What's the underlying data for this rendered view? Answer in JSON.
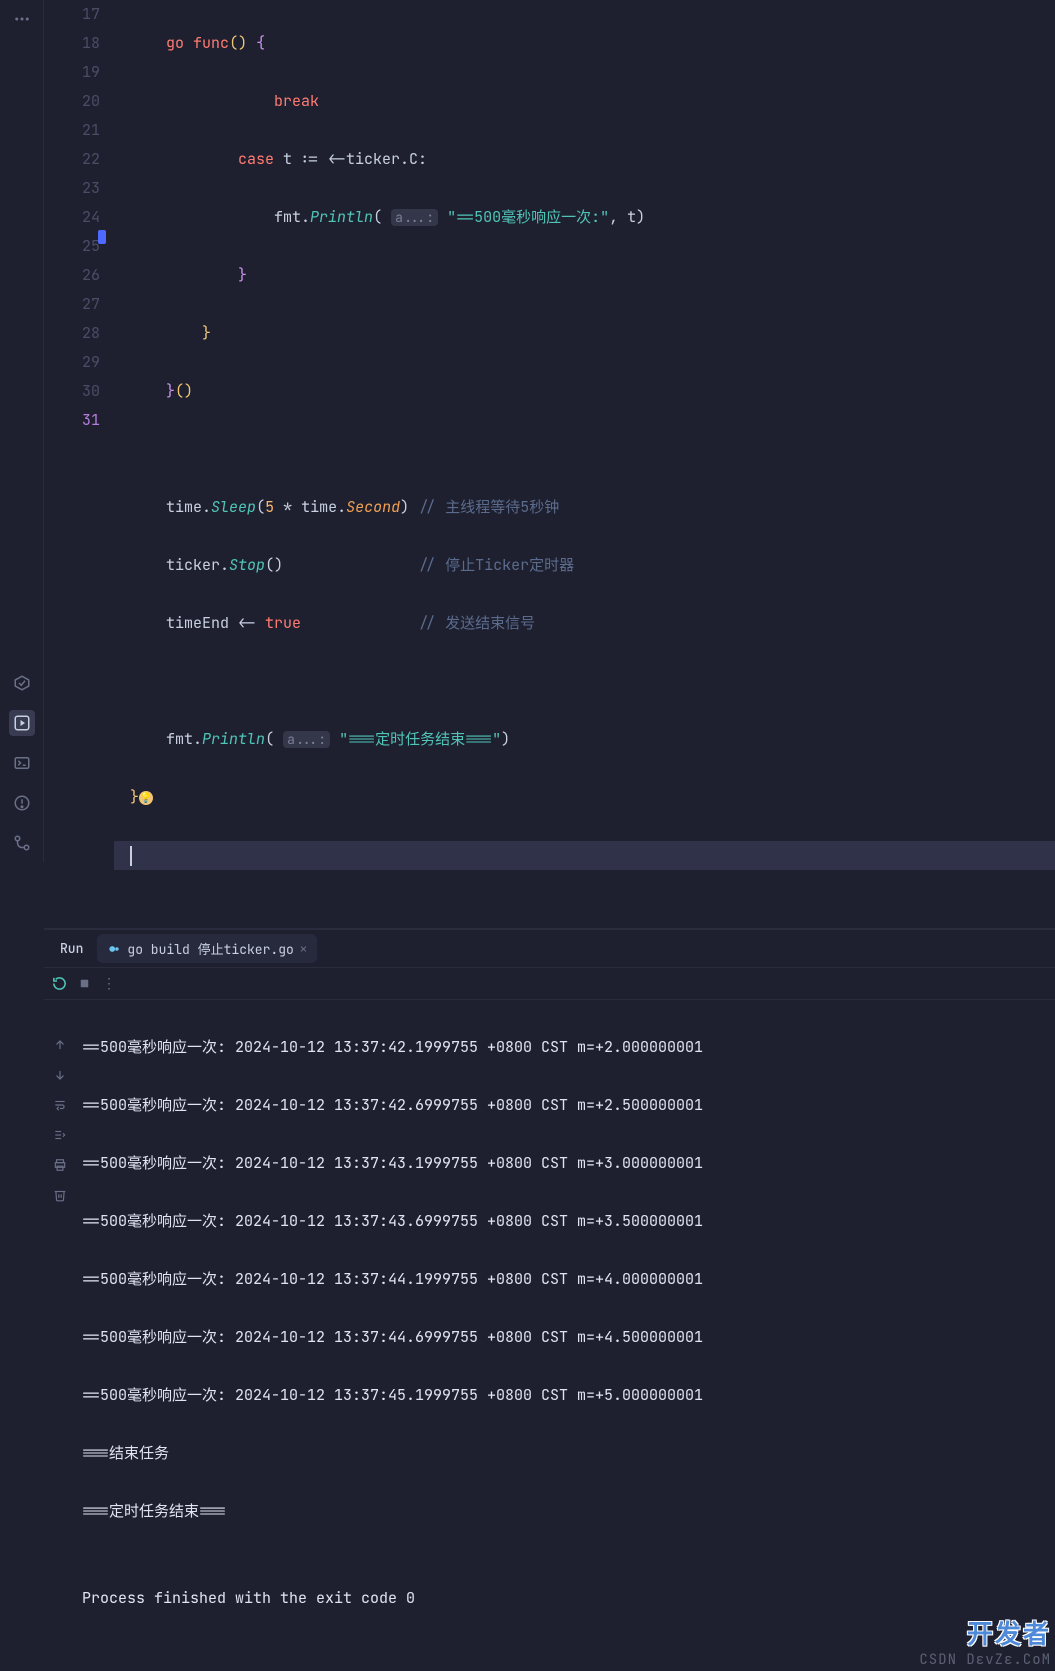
{
  "editor": {
    "lines": [
      {
        "num": 17
      },
      {
        "num": 18
      },
      {
        "num": 19
      },
      {
        "num": 20
      },
      {
        "num": 21
      },
      {
        "num": 22
      },
      {
        "num": 23
      },
      {
        "num": 24
      },
      {
        "num": 25
      },
      {
        "num": 26
      },
      {
        "num": 27
      },
      {
        "num": 28
      },
      {
        "num": 29
      },
      {
        "num": 30
      },
      {
        "num": 31,
        "current": true
      }
    ],
    "tokens": {
      "go": "go",
      "func": "func",
      "break": "break",
      "case": "case",
      "t_assign": "t := <-ticker.C:",
      "fmt": "fmt",
      "Println": "Println",
      "hint": "a...:",
      "str500": "\"==500毫秒响应一次:\"",
      "t_arg": ", t)",
      "time": "time",
      "Sleep": "Sleep",
      "five": "5",
      "mul": " * ",
      "timePkg": "time",
      "Second": "Second",
      "comment_wait": "// 主线程等待5秒钟",
      "ticker": "ticker",
      "Stop": "Stop",
      "comment_stop": "// 停止Ticker定时器",
      "timeEnd": "timeEnd <- ",
      "true": "true",
      "comment_end": "// 发送结束信号",
      "str_end": "\"===定时任务结束===\""
    }
  },
  "run": {
    "label": "Run",
    "tab": "go build 停止ticker.go",
    "output_lines": [
      "==500毫秒响应一次: 2024-10-12 13:37:42.1999755 +0800 CST m=+2.000000001",
      "==500毫秒响应一次: 2024-10-12 13:37:42.6999755 +0800 CST m=+2.500000001",
      "==500毫秒响应一次: 2024-10-12 13:37:43.1999755 +0800 CST m=+3.000000001",
      "==500毫秒响应一次: 2024-10-12 13:37:43.6999755 +0800 CST m=+3.500000001",
      "==500毫秒响应一次: 2024-10-12 13:37:44.1999755 +0800 CST m=+4.000000001",
      "==500毫秒响应一次: 2024-10-12 13:37:44.6999755 +0800 CST m=+4.500000001",
      "==500毫秒响应一次: 2024-10-12 13:37:45.1999755 +0800 CST m=+5.000000001",
      "===结束任务",
      "===定时任务结束===",
      "",
      "Process finished with the exit code 0"
    ]
  },
  "watermark": {
    "top": "开发者",
    "bottom": "CSDN  DεvZε.CοM"
  }
}
